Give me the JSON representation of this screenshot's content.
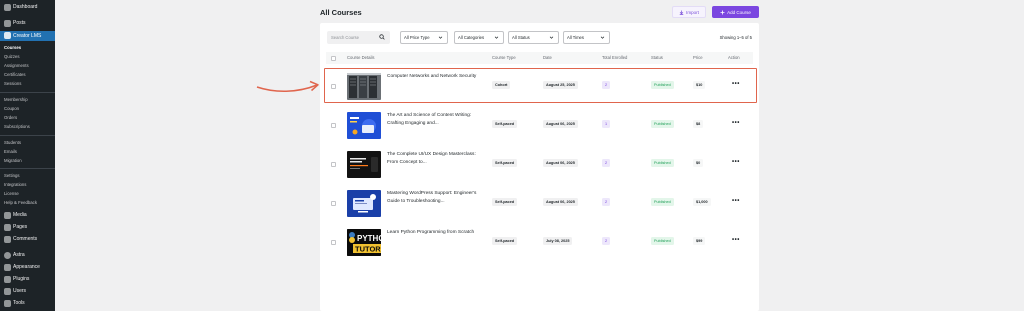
{
  "sidebar": {
    "top": {
      "dashboard": "Dashboard",
      "posts": "Posts",
      "creator_lms": "Creator LMS"
    },
    "lms_group1": [
      "Courses",
      "Quizzes",
      "Assignments",
      "Certificates",
      "Sessions"
    ],
    "lms_group2": [
      "Membership",
      "Coupon",
      "Orders",
      "Subscriptions"
    ],
    "lms_group3": [
      "Students",
      "Emails",
      "Migration"
    ],
    "lms_group4": [
      "Settings",
      "Integrations",
      "License",
      "Help & Feedback"
    ],
    "bottom": [
      "Media",
      "Pages",
      "Comments",
      "Astra",
      "Appearance",
      "Plugins",
      "Users",
      "Tools"
    ]
  },
  "header": {
    "title": "All Courses",
    "import_label": "Import",
    "add_label": "Add Course",
    "import_icon": "download-icon",
    "add_icon": "plus-icon"
  },
  "filters": {
    "search_placeholder": "Search Course",
    "price_type": "All Price Type",
    "categories": "All Categories",
    "status": "All Status",
    "times": "All Times",
    "showing": "Showing 1–5 of 5"
  },
  "table": {
    "columns": [
      "Course Details",
      "Course Type",
      "Date",
      "Total Enrolled",
      "Status",
      "Price",
      "Action"
    ],
    "rows": [
      {
        "title": "Computer Networks and Network Security",
        "type": "Cohort",
        "date": "August 25, 2025",
        "enrolled": "2",
        "status": "Published",
        "price": "$10"
      },
      {
        "title": "The Art and Science of Content Writing: Crafting Engaging and...",
        "type": "Self-paced",
        "date": "August 06, 2025",
        "enrolled": "1",
        "status": "Published",
        "price": "$8"
      },
      {
        "title": "The Complete UI/UX Design Masterclass: From Concept to...",
        "type": "Self-paced",
        "date": "August 06, 2025",
        "enrolled": "2",
        "status": "Published",
        "price": "$0"
      },
      {
        "title": "Mastering WordPress Support: Engineer's Guide to Troubleshooting...",
        "type": "Self-paced",
        "date": "August 06, 2025",
        "enrolled": "2",
        "status": "Published",
        "price": "$1,000"
      },
      {
        "title": "Learn Python Programming from Scratch",
        "type": "Self-paced",
        "date": "July 08, 2025",
        "enrolled": "2",
        "status": "Published",
        "price": "$99"
      }
    ]
  },
  "colors": {
    "accent": "#7b46e0",
    "sidebar": "#1d2327",
    "active": "#2271b1",
    "highlight": "#e0654d",
    "published": "#1f9f57"
  },
  "thumbnail_text": {
    "python": "PYTHO TUTORIA"
  }
}
